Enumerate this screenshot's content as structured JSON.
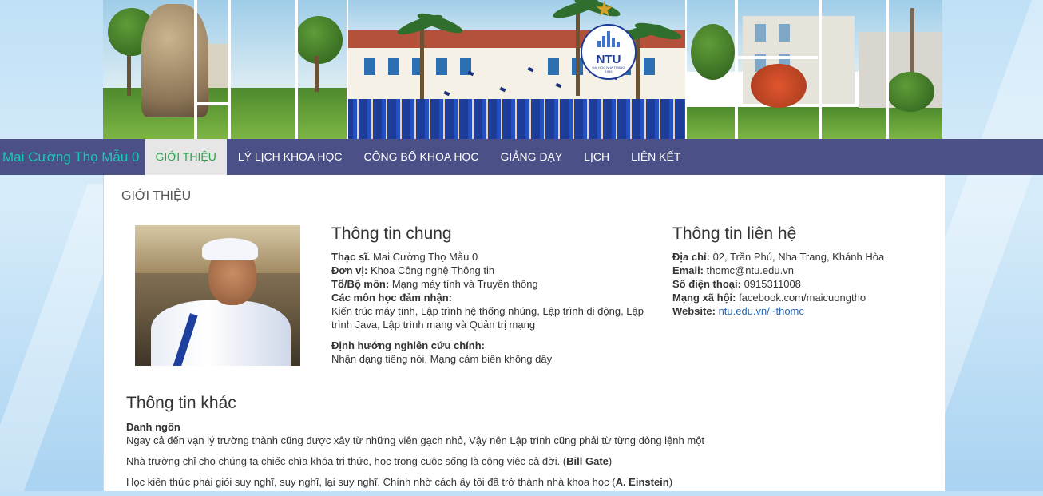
{
  "colors": {
    "nav_bg": "#4b5086",
    "brand": "#19c9b6",
    "active_tab_bg": "#e6e6e6",
    "active_tab_text": "#2aa24a",
    "link": "#2a6ab8"
  },
  "banner": {
    "logo_text": "NTU",
    "logo_caption": "ĐẠI HỌC NHA TRANG",
    "logo_year": "1959"
  },
  "nav": {
    "brand": "Mai Cường Thọ Mẫu 0",
    "items": [
      {
        "label": "GIỚI THIỆU",
        "active": true
      },
      {
        "label": "LÝ LỊCH KHOA HỌC",
        "active": false
      },
      {
        "label": "CÔNG BỐ KHOA HỌC",
        "active": false
      },
      {
        "label": "GIẢNG DẠY",
        "active": false
      },
      {
        "label": "LỊCH",
        "active": false
      },
      {
        "label": "LIÊN KẾT",
        "active": false
      }
    ]
  },
  "page": {
    "section_title": "GIỚI THIỆU"
  },
  "general": {
    "heading": "Thông tin chung",
    "degree_label": "Thạc sĩ.",
    "degree_value": " Mai Cường Thọ Mẫu 0",
    "unit_label": "Đơn vị:",
    "unit_value": " Khoa Công nghệ Thông tin",
    "dept_label": "Tổ/Bộ môn:",
    "dept_value": " Mạng máy tính và Truyền thông",
    "courses_label": "Các môn học đảm nhận:",
    "courses_value": "Kiến trúc máy tính, Lập trình hệ thống nhúng, Lập trình di động, Lập trình Java, Lập trình mạng và Quản trị mạng",
    "research_label": "Định hướng nghiên cứu chính:",
    "research_value": "Nhận dạng tiếng nói, Mạng cảm biến không dây"
  },
  "contact": {
    "heading": "Thông tin liên hệ",
    "address_label": "Địa chỉ:",
    "address_value": " 02, Trần Phú, Nha Trang, Khánh Hòa",
    "email_label": "Email:",
    "email_value": " thomc@ntu.edu.vn",
    "phone_label": "Số điện thoại:",
    "phone_value": " 0915311008",
    "social_label": "Mạng xã hội:",
    "social_value": " facebook.com/maicuongtho",
    "website_label": "Website:",
    "website_value": "ntu.edu.vn/~thomc"
  },
  "other": {
    "heading": "Thông tin khác",
    "quotes_label": "Danh ngôn",
    "quote1": "Ngay cả đến vạn lý trường thành cũng được xây từ những viên gạch nhỏ, Vậy nên Lập trình cũng phải từ từng dòng lệnh một",
    "quote2_text": "Nhà trường chỉ cho chúng ta chiếc chìa khóa tri thức, học trong cuộc sống là công việc cả đời. (",
    "quote2_author": "Bill Gate",
    "quote2_close": ")",
    "quote3_text": " Học kiến thức phải giỏi suy nghĩ, suy nghĩ, lại suy nghĩ. Chính nhờ cách ấy tôi đã trở thành nhà khoa học (",
    "quote3_author": "A. Einstein",
    "quote3_close": ")"
  }
}
